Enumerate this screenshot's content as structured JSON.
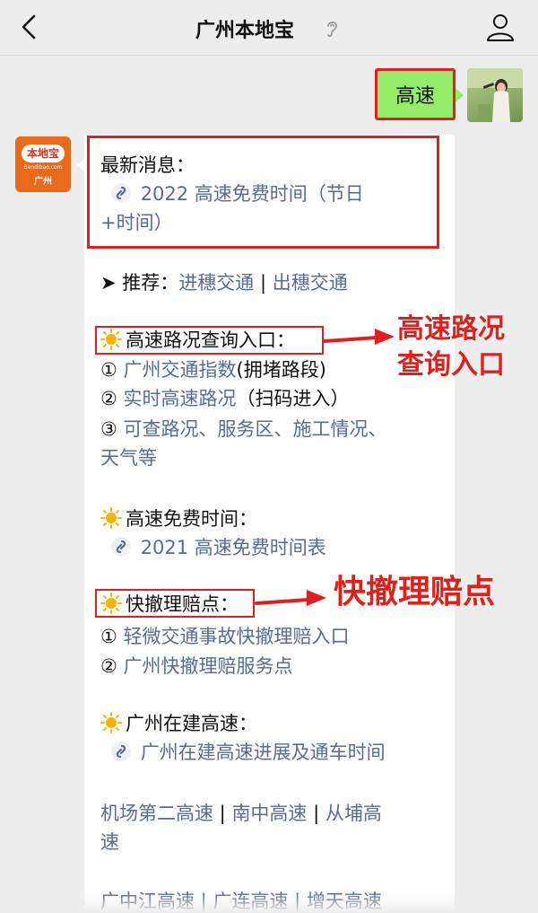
{
  "header": {
    "title": "广州本地宝"
  },
  "outgoing": {
    "text": "高速"
  },
  "bot_logo": {
    "brand": "本地宝",
    "url": "Bendibao.com",
    "city": "广州"
  },
  "message": {
    "news_heading": "最新消息：",
    "news_link_line1": "2022 高速免费时间（节日",
    "news_link_line2": "+时间）",
    "recommend_prefix": "➤ 推荐：",
    "recommend_link1": "进穗交通",
    "recommend_sep": " | ",
    "recommend_link2": "出穗交通",
    "traffic_heading": "高速路况查询入口：",
    "traffic_item1_prefix": "① ",
    "traffic_item1_link": "广州交通指数",
    "traffic_item1_suffix": "(拥堵路段)",
    "traffic_item2_prefix": "② ",
    "traffic_item2_link": "实时高速路况",
    "traffic_item2_suffix": "（扫码进入）",
    "traffic_item3_prefix": "③ ",
    "traffic_item3_link_line1": "可查路况、服务区、施工情况、",
    "traffic_item3_link_line2": "天气等",
    "free_heading": "高速免费时间：",
    "free_link": "2021 高速免费时间表",
    "claim_heading": "快撤理赔点：",
    "claim_item1_prefix": "① ",
    "claim_item1_link": "轻微交通事故快撤理赔入口",
    "claim_item2_prefix": "② ",
    "claim_item2_link": "广州快撤理赔服务点",
    "construction_heading": "广州在建高速：",
    "construction_link": "广州在建高速进展及通车时间",
    "roads_line1_a": "机场第二高速",
    "roads_line1_sep1": " | ",
    "roads_line1_b": "南中高速",
    "roads_line1_sep2": " | ",
    "roads_line1_c": "从埔高",
    "roads_line2": "速",
    "roads_line3_partial": "广中江高速 | 广连高速 | 增天高速"
  },
  "annotations": {
    "traffic_line1": "高速路况",
    "traffic_line2": "查询入口",
    "claim": "快撤理赔点"
  },
  "colors": {
    "link": "#576b95",
    "annotation_red": "#e02020",
    "outgoing_bubble": "#95ec69",
    "background": "#ededed",
    "logo_orange": "#e86a1a"
  }
}
